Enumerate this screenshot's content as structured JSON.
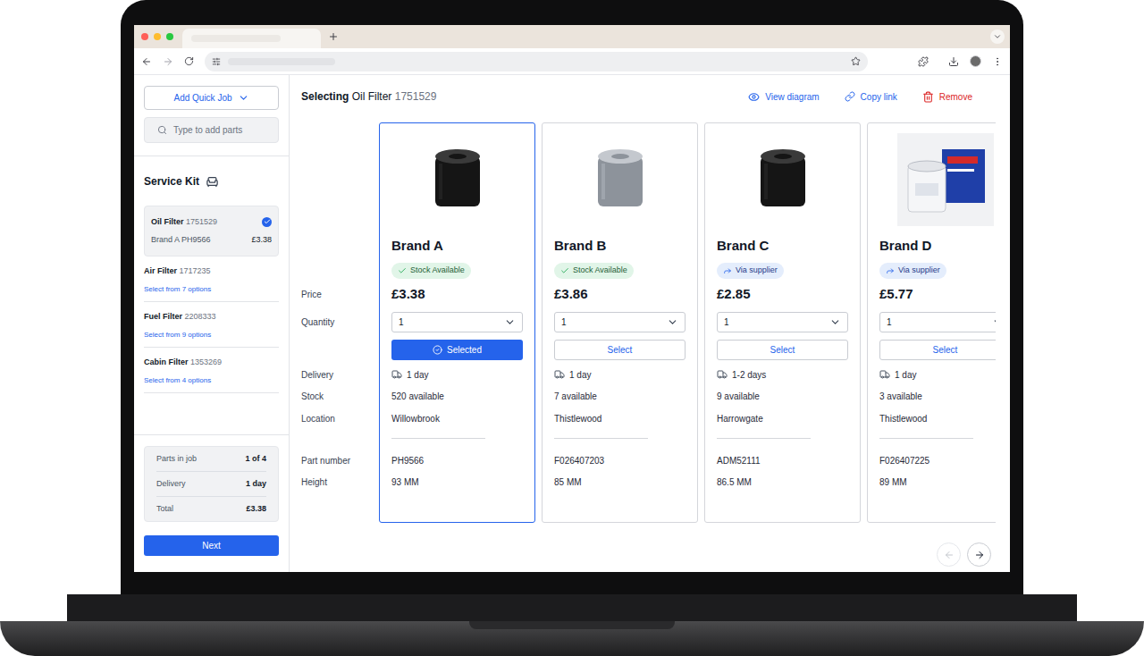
{
  "sidebar": {
    "add_button": "Add Quick Job",
    "search_placeholder": "Type to add parts",
    "kit_title": "Service Kit",
    "items": [
      {
        "name": "Oil Filter",
        "code": "1751529",
        "selected": true,
        "done": true,
        "brand": "Brand A PH9566",
        "price": "£3.38",
        "action": ""
      },
      {
        "name": "Air Filter",
        "code": "1717235",
        "selected": false,
        "done": false,
        "brand": "",
        "price": "",
        "action": "Select from 7 options"
      },
      {
        "name": "Fuel Filter",
        "code": "2208333",
        "selected": false,
        "done": false,
        "brand": "",
        "price": "",
        "action": "Select from 9 options"
      },
      {
        "name": "Cabin Filter",
        "code": "1353269",
        "selected": false,
        "done": false,
        "brand": "",
        "price": "",
        "action": "Select from 4 options"
      }
    ],
    "summary": [
      {
        "label": "Parts in job",
        "value": "1 of 4"
      },
      {
        "label": "Delivery",
        "value": "1 day"
      },
      {
        "label": "Total",
        "value": "£3.38"
      }
    ],
    "next_button": "Next"
  },
  "main": {
    "heading": {
      "prefix": "Selecting",
      "part": "Oil Filter",
      "code": "1751529"
    },
    "actions": [
      {
        "label": "View diagram",
        "kind": "view"
      },
      {
        "label": "Copy link",
        "kind": "link"
      },
      {
        "label": "Remove",
        "kind": "remove"
      }
    ],
    "row_labels": [
      "Price",
      "Quantity",
      "Delivery",
      "Stock",
      "Location",
      "Part number",
      "Height"
    ],
    "cards": [
      {
        "brand": "Brand A",
        "image_kind": "dark",
        "availability": "Stock Available",
        "availability_kind": "stock",
        "price": "£3.38",
        "quantity": "1",
        "selected": true,
        "button": "Selected",
        "delivery": "1 day",
        "stock": "520 available",
        "location": "Willowbrook",
        "part_number": "PH9566",
        "height": "93 MM"
      },
      {
        "brand": "Brand B",
        "image_kind": "silver",
        "availability": "Stock Available",
        "availability_kind": "stock",
        "price": "£3.86",
        "quantity": "1",
        "selected": false,
        "button": "Select",
        "delivery": "1 day",
        "stock": "7 available",
        "location": "Thistlewood",
        "part_number": "F026407203",
        "height": "85 MM"
      },
      {
        "brand": "Brand C",
        "image_kind": "dark",
        "availability": "Via supplier",
        "availability_kind": "supplier",
        "price": "£2.85",
        "quantity": "1",
        "selected": false,
        "button": "Select",
        "delivery": "1-2 days",
        "stock": "9 available",
        "location": "Harrowgate",
        "part_number": "ADM52111",
        "height": "86.5 MM"
      },
      {
        "brand": "Brand D",
        "image_kind": "boxed",
        "availability": "Via supplier",
        "availability_kind": "supplier",
        "price": "£5.77",
        "quantity": "1",
        "selected": false,
        "button": "Select",
        "delivery": "1 day",
        "stock": "3 available",
        "location": "Thistlewood",
        "part_number": "F026407225",
        "height": "89 MM"
      }
    ],
    "pagination": {
      "prev_disabled": true,
      "next_disabled": false
    }
  }
}
